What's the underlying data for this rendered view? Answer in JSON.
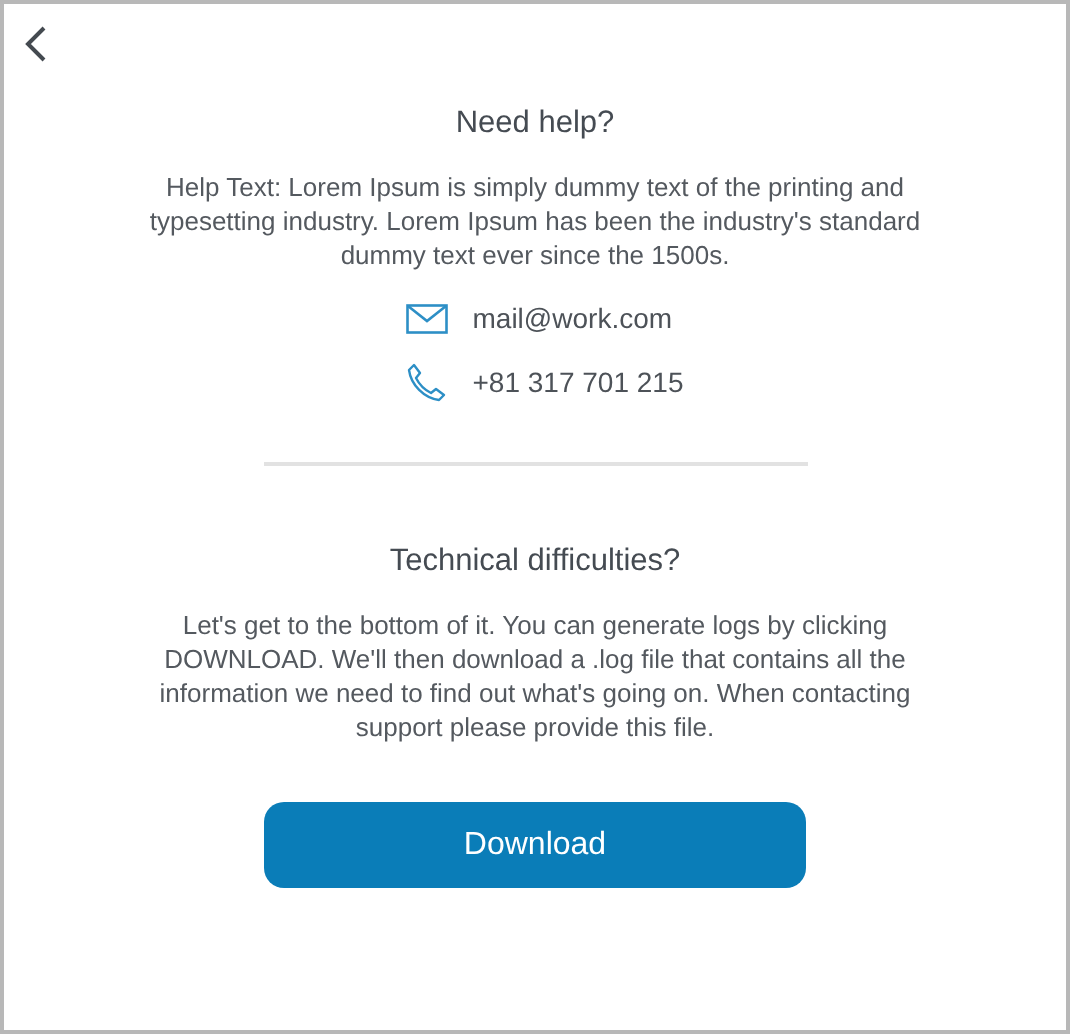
{
  "help": {
    "title": "Need help?",
    "text": "Help Text: Lorem Ipsum is simply dummy text of the printing and typesetting industry. Lorem Ipsum has been the industry's standard dummy text ever since the 1500s.",
    "contacts": [
      {
        "kind": "email",
        "text": "mail@work.com"
      },
      {
        "kind": "phone",
        "text": "+81 317 701 215"
      }
    ]
  },
  "technical": {
    "title": "Technical difficulties?",
    "text": "Let's get to the bottom of it. You can generate logs by clicking DOWNLOAD. We'll then download a .log file that contains all the information we need to find out what's going on. When contacting support please provide this file.",
    "button": "Download"
  }
}
